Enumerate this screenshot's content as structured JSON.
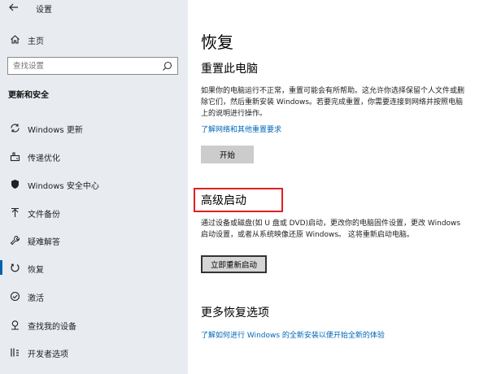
{
  "window": {
    "title": "设置"
  },
  "sidebar": {
    "home_label": "主页",
    "search_placeholder": "查找设置",
    "section_title": "更新和安全",
    "items": [
      {
        "label": "Windows 更新",
        "icon": "sync-icon"
      },
      {
        "label": "传递优化",
        "icon": "delivery-optimization-icon"
      },
      {
        "label": "Windows 安全中心",
        "icon": "shield-icon"
      },
      {
        "label": "文件备份",
        "icon": "backup-icon"
      },
      {
        "label": "疑难解答",
        "icon": "wrench-icon"
      },
      {
        "label": "恢复",
        "icon": "recovery-icon",
        "active": true
      },
      {
        "label": "激活",
        "icon": "activation-icon"
      },
      {
        "label": "查找我的设备",
        "icon": "find-device-icon"
      },
      {
        "label": "开发者选项",
        "icon": "developer-icon"
      }
    ]
  },
  "main": {
    "title": "恢复",
    "reset": {
      "heading": "重置此电脑",
      "description": "如果你的电脑运行不正常，重置可能会有所帮助。这允许你选择保留个人文件或删除它们，然后重新安装 Windows。若要完成重置，你需要连接到网络并按照电脑上的说明进行操作。",
      "link": "了解网络和其他重置要求",
      "button": "开始"
    },
    "advanced": {
      "heading": "高级启动",
      "description": "通过设备或磁盘(如 U 盘或 DVD)启动，更改你的电脑固件设置，更改 Windows 启动设置，或者从系统映像还原 Windows。 这将重新启动电脑。",
      "button": "立即重新启动"
    },
    "more": {
      "heading": "更多恢复选项",
      "link": "了解如何进行 Windows 的全新安装以便开始全新的体验"
    }
  },
  "colors": {
    "accent": "#0067b8",
    "highlight": "#e02020",
    "sidebar_bg": "#e8ecf1"
  }
}
